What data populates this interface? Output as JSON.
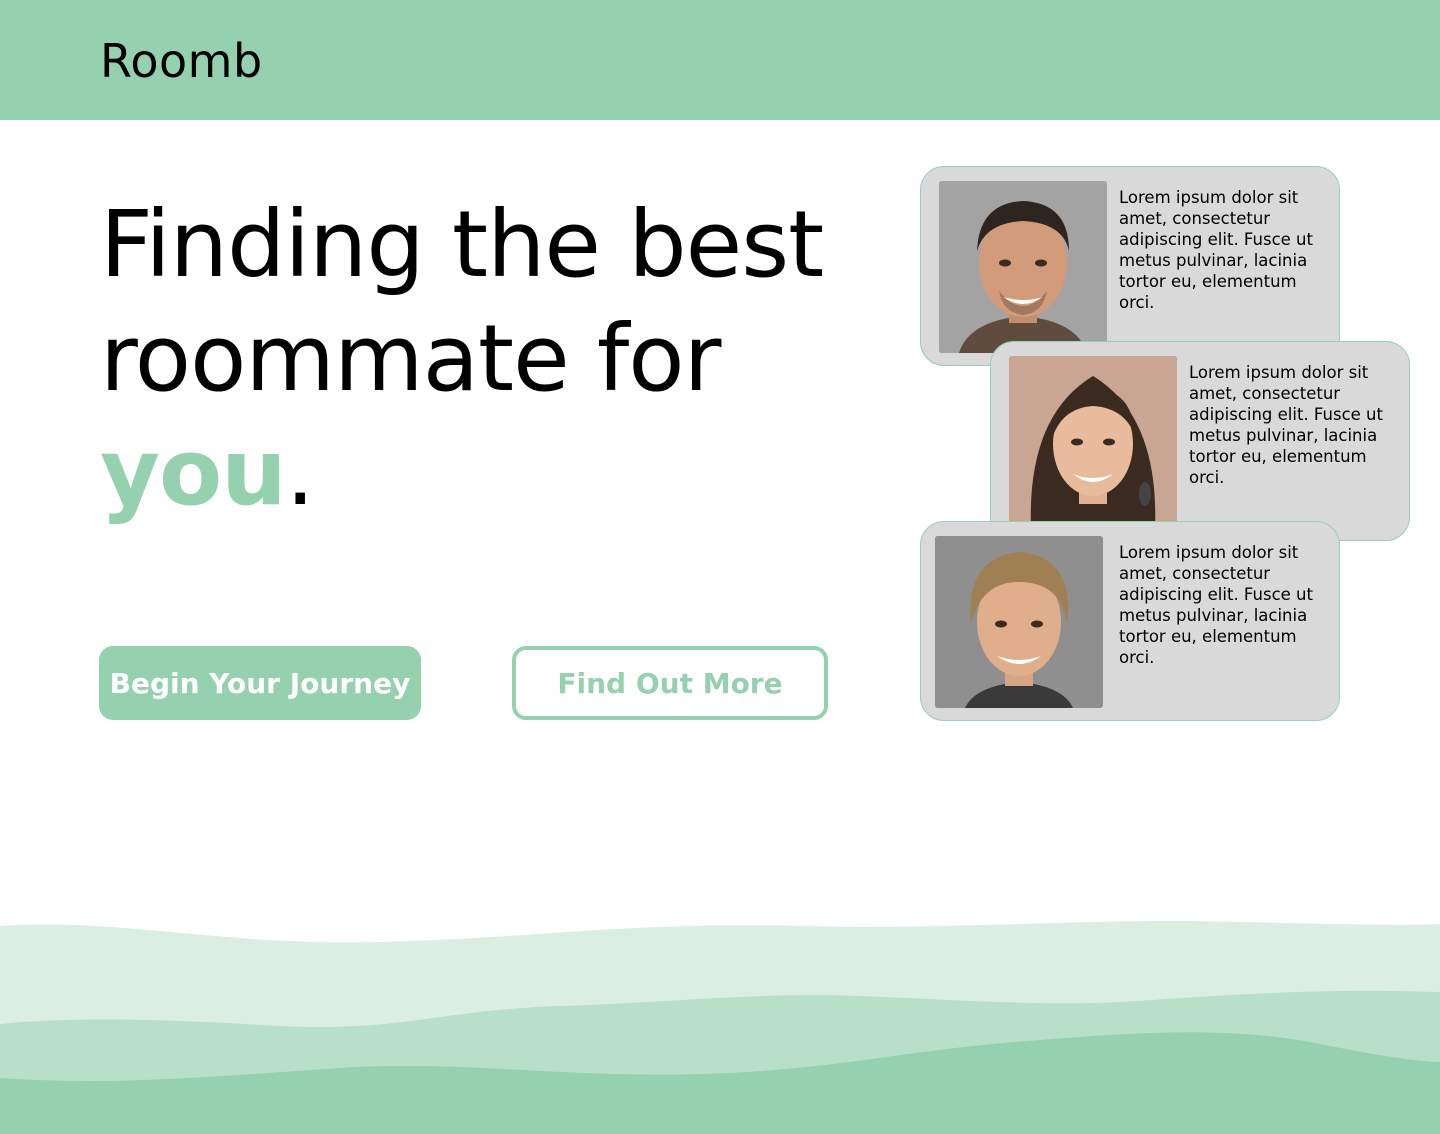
{
  "header": {
    "brand": "Roomb"
  },
  "hero": {
    "line1": "Finding the best",
    "line2": "roommate for",
    "accent": "you",
    "period": "."
  },
  "buttons": {
    "primary": "Begin Your Journey",
    "secondary": "Find Out More"
  },
  "cards": [
    {
      "text": "Lorem ipsum dolor sit amet, consectetur adipiscing elit. Fusce ut metus pulvinar, lacinia tortor eu, elementum orci."
    },
    {
      "text": "Lorem ipsum dolor sit amet, consectetur adipiscing elit. Fusce ut metus pulvinar, lacinia tortor eu, elementum orci."
    },
    {
      "text": "Lorem ipsum dolor sit amet, consectetur adipiscing elit. Fusce ut metus pulvinar, lacinia tortor eu, elementum orci."
    }
  ],
  "colors": {
    "accent": "#95d1ae",
    "card_bg": "#d9d9d9",
    "wave_light": "#dbeee3",
    "wave_mid": "#b8e0c8",
    "wave_dark": "#95d1ae"
  }
}
